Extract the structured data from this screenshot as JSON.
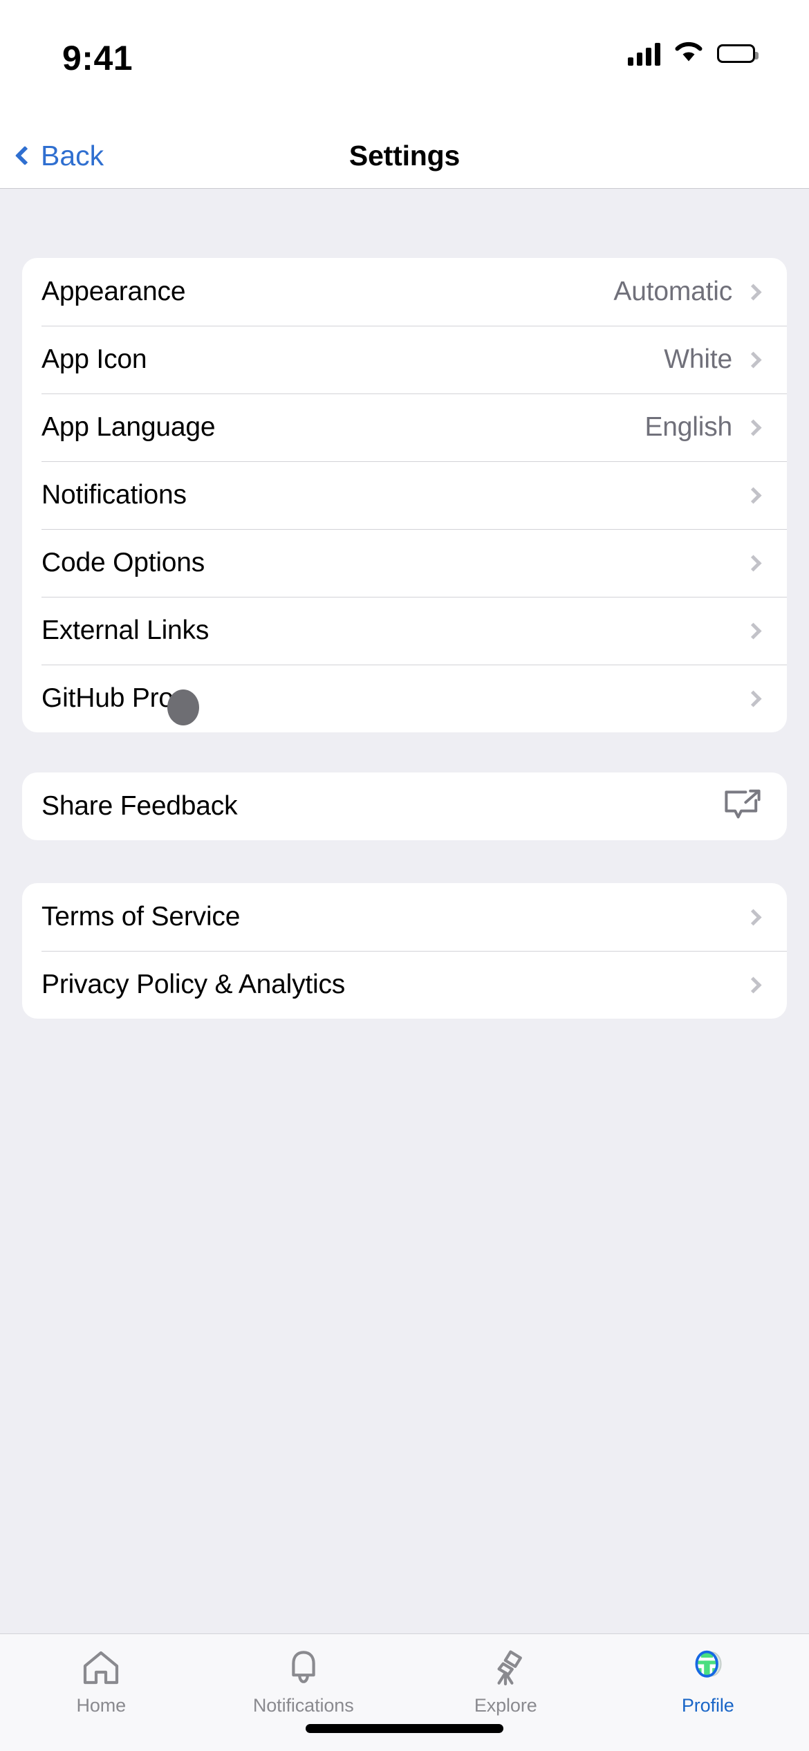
{
  "status_bar": {
    "time": "9:41",
    "signal_icon": "cellular-signal-icon",
    "wifi_icon": "wifi-icon",
    "battery_icon": "battery-full-icon"
  },
  "nav_bar": {
    "back_label": "Back",
    "back_icon": "chevron-left-icon",
    "title": "Settings"
  },
  "colors": {
    "accent_blue": "#2f6fd0",
    "tab_active_blue": "#1a66c7",
    "value_gray": "#70707a",
    "chevron_gray": "#c2c2c8",
    "page_background": "#eeeef3",
    "card_background": "#ffffff",
    "avatar_green": "#4ade80"
  },
  "groups": [
    {
      "name": "preferences-group",
      "rows": [
        {
          "label": "Appearance",
          "value": "Automatic",
          "accessory": "chevron-right-icon"
        },
        {
          "label": "App Icon",
          "value": "White",
          "accessory": "chevron-right-icon"
        },
        {
          "label": "App Language",
          "value": "English",
          "accessory": "chevron-right-icon"
        },
        {
          "label": "Notifications",
          "value": "",
          "accessory": "chevron-right-icon"
        },
        {
          "label": "Code Options",
          "value": "",
          "accessory": "chevron-right-icon"
        },
        {
          "label": "External Links",
          "value": "",
          "accessory": "chevron-right-icon"
        },
        {
          "label": "GitHub Pro",
          "value": "",
          "accessory": "chevron-right-icon"
        }
      ]
    },
    {
      "name": "feedback-group",
      "rows": [
        {
          "label": "Share Feedback",
          "value": "",
          "accessory": "share-feedback-icon"
        }
      ]
    },
    {
      "name": "legal-group",
      "rows": [
        {
          "label": "Terms of Service",
          "value": "",
          "accessory": "chevron-right-icon"
        },
        {
          "label": "Privacy Policy & Analytics",
          "value": "",
          "accessory": "chevron-right-icon"
        }
      ]
    }
  ],
  "tab_bar": {
    "items": [
      {
        "label": "Home",
        "icon": "home-icon",
        "active": false
      },
      {
        "label": "Notifications",
        "icon": "bell-icon",
        "active": false
      },
      {
        "label": "Explore",
        "icon": "telescope-icon",
        "active": false
      },
      {
        "label": "Profile",
        "icon": "avatar-icon",
        "active": true
      }
    ]
  }
}
